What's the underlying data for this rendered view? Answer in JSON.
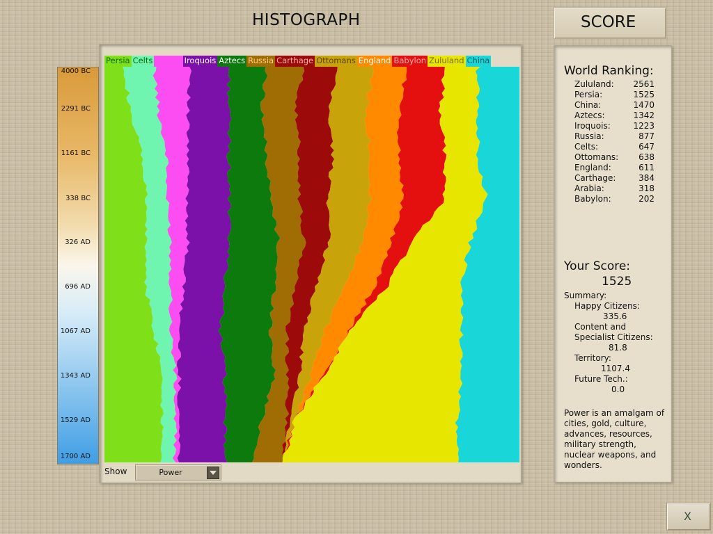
{
  "header": {
    "histograph_title": "HISTOGRAPH",
    "score_tab": "SCORE"
  },
  "timeline": [
    "4000 BC",
    "2291 BC",
    "1161 BC",
    "338 BC",
    "326 AD",
    "696 AD",
    "1067 AD",
    "1343 AD",
    "1529 AD",
    "1700 AD"
  ],
  "controls": {
    "show_label": "Show",
    "metric_selected": "Power",
    "close_label": "X"
  },
  "civs": [
    {
      "name": "Persia",
      "color": "#7fe01a",
      "label_color": "#0b6a0b"
    },
    {
      "name": "Celts",
      "color": "#6ff5b0",
      "label_color": "#0b6a0b"
    },
    {
      "name": "Arabia",
      "color": "#fb4df1",
      "label_color": "#fb4df1"
    },
    {
      "name": "Iroquois",
      "color": "#7b11a8",
      "label_color": "#ffffff"
    },
    {
      "name": "Aztecs",
      "color": "#0c7a0c",
      "label_color": "#ffffff"
    },
    {
      "name": "Russia",
      "color": "#a06d05",
      "label_color": "#ffd080"
    },
    {
      "name": "Carthage",
      "color": "#9c0a0a",
      "label_color": "#ffb0b0"
    },
    {
      "name": "Ottomans",
      "color": "#c9a30a",
      "label_color": "#5a4300"
    },
    {
      "name": "England",
      "color": "#ff8a00",
      "label_color": "#ffffff"
    },
    {
      "name": "Babylon",
      "color": "#e41010",
      "label_color": "#ffb0b0"
    },
    {
      "name": "Zululand",
      "color": "#e6e600",
      "label_color": "#7a6a00"
    },
    {
      "name": "China",
      "color": "#19d6d9",
      "label_color": "#0a5a5a"
    }
  ],
  "chart_data": {
    "type": "area",
    "stacked": true,
    "normalized": true,
    "metric": "Power",
    "x": [
      "4000 BC",
      "2291 BC",
      "1161 BC",
      "338 BC",
      "326 AD",
      "696 AD",
      "1067 AD",
      "1343 AD",
      "1529 AD",
      "1700 AD"
    ],
    "series": [
      {
        "name": "Persia",
        "values": [
          5,
          6,
          9,
          10,
          10,
          10,
          12,
          14,
          14,
          14
        ]
      },
      {
        "name": "Celts",
        "values": [
          7,
          7,
          6,
          5,
          6,
          6,
          4,
          3,
          3,
          3
        ]
      },
      {
        "name": "Arabia",
        "values": [
          9,
          7,
          5,
          5,
          4,
          3,
          2,
          1,
          1,
          1
        ]
      },
      {
        "name": "Iroquois",
        "values": [
          9,
          10,
          10,
          10,
          10,
          10,
          10,
          11,
          11,
          11
        ]
      },
      {
        "name": "Aztecs",
        "values": [
          9,
          8,
          9,
          10,
          12,
          12,
          12,
          12,
          9,
          7
        ]
      },
      {
        "name": "Russia",
        "values": [
          9,
          8,
          8,
          7,
          6,
          5,
          4,
          3,
          6,
          7
        ]
      },
      {
        "name": "Carthage",
        "values": [
          8,
          8,
          8,
          7,
          6,
          5,
          4,
          3,
          1,
          0
        ]
      },
      {
        "name": "Ottomans",
        "values": [
          9,
          9,
          9,
          10,
          8,
          7,
          5,
          3,
          1,
          0
        ]
      },
      {
        "name": "England",
        "values": [
          8,
          8,
          7,
          8,
          7,
          7,
          6,
          3,
          0,
          0
        ]
      },
      {
        "name": "Babylon",
        "values": [
          9,
          10,
          11,
          10,
          5,
          3,
          0,
          0,
          0,
          0
        ]
      },
      {
        "name": "Zululand",
        "values": [
          8,
          9,
          8,
          10,
          14,
          18,
          27,
          33,
          39,
          42
        ]
      },
      {
        "name": "China",
        "values": [
          10,
          10,
          10,
          8,
          12,
          14,
          14,
          14,
          15,
          15
        ]
      }
    ]
  },
  "ranking": {
    "heading": "World Ranking:",
    "rows": [
      {
        "civ": "Zululand:",
        "score": "2561"
      },
      {
        "civ": "Persia:",
        "score": "1525"
      },
      {
        "civ": "China:",
        "score": "1470"
      },
      {
        "civ": "Aztecs:",
        "score": "1342"
      },
      {
        "civ": "Iroquois:",
        "score": "1223"
      },
      {
        "civ": "Russia:",
        "score": "877"
      },
      {
        "civ": "Celts:",
        "score": "647"
      },
      {
        "civ": "Ottomans:",
        "score": "638"
      },
      {
        "civ": "England:",
        "score": "611"
      },
      {
        "civ": "Carthage:",
        "score": "384"
      },
      {
        "civ": "Arabia:",
        "score": "318"
      },
      {
        "civ": "Babylon:",
        "score": "202"
      }
    ]
  },
  "your_score": {
    "heading": "Your Score:",
    "value": "1525",
    "summary_label": "Summary:",
    "happy_label": "Happy Citizens:",
    "happy_value": "335.6",
    "content_label_1": "Content and",
    "content_label_2": "Specialist Citizens:",
    "content_value": "81.8",
    "territory_label": "Territory:",
    "territory_value": "1107.4",
    "future_label": "Future Tech.:",
    "future_value": "0.0"
  },
  "description": "Power is an amalgam of cities, gold, culture, advances, resources, military strength, nuclear weapons, and wonders."
}
